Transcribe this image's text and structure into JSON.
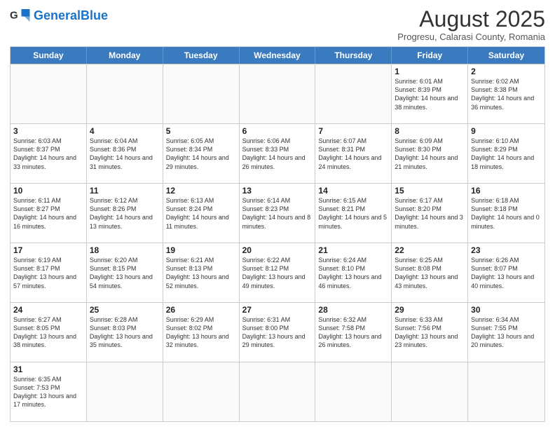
{
  "logo": {
    "text_normal": "General",
    "text_blue": "Blue"
  },
  "title": {
    "month_year": "August 2025",
    "location": "Progresu, Calarasi County, Romania"
  },
  "days_of_week": [
    "Sunday",
    "Monday",
    "Tuesday",
    "Wednesday",
    "Thursday",
    "Friday",
    "Saturday"
  ],
  "weeks": [
    [
      {
        "day": "",
        "info": ""
      },
      {
        "day": "",
        "info": ""
      },
      {
        "day": "",
        "info": ""
      },
      {
        "day": "",
        "info": ""
      },
      {
        "day": "",
        "info": ""
      },
      {
        "day": "1",
        "info": "Sunrise: 6:01 AM\nSunset: 8:39 PM\nDaylight: 14 hours and 38 minutes."
      },
      {
        "day": "2",
        "info": "Sunrise: 6:02 AM\nSunset: 8:38 PM\nDaylight: 14 hours and 36 minutes."
      }
    ],
    [
      {
        "day": "3",
        "info": "Sunrise: 6:03 AM\nSunset: 8:37 PM\nDaylight: 14 hours and 33 minutes."
      },
      {
        "day": "4",
        "info": "Sunrise: 6:04 AM\nSunset: 8:36 PM\nDaylight: 14 hours and 31 minutes."
      },
      {
        "day": "5",
        "info": "Sunrise: 6:05 AM\nSunset: 8:34 PM\nDaylight: 14 hours and 29 minutes."
      },
      {
        "day": "6",
        "info": "Sunrise: 6:06 AM\nSunset: 8:33 PM\nDaylight: 14 hours and 26 minutes."
      },
      {
        "day": "7",
        "info": "Sunrise: 6:07 AM\nSunset: 8:31 PM\nDaylight: 14 hours and 24 minutes."
      },
      {
        "day": "8",
        "info": "Sunrise: 6:09 AM\nSunset: 8:30 PM\nDaylight: 14 hours and 21 minutes."
      },
      {
        "day": "9",
        "info": "Sunrise: 6:10 AM\nSunset: 8:29 PM\nDaylight: 14 hours and 18 minutes."
      }
    ],
    [
      {
        "day": "10",
        "info": "Sunrise: 6:11 AM\nSunset: 8:27 PM\nDaylight: 14 hours and 16 minutes."
      },
      {
        "day": "11",
        "info": "Sunrise: 6:12 AM\nSunset: 8:26 PM\nDaylight: 14 hours and 13 minutes."
      },
      {
        "day": "12",
        "info": "Sunrise: 6:13 AM\nSunset: 8:24 PM\nDaylight: 14 hours and 11 minutes."
      },
      {
        "day": "13",
        "info": "Sunrise: 6:14 AM\nSunset: 8:23 PM\nDaylight: 14 hours and 8 minutes."
      },
      {
        "day": "14",
        "info": "Sunrise: 6:15 AM\nSunset: 8:21 PM\nDaylight: 14 hours and 5 minutes."
      },
      {
        "day": "15",
        "info": "Sunrise: 6:17 AM\nSunset: 8:20 PM\nDaylight: 14 hours and 3 minutes."
      },
      {
        "day": "16",
        "info": "Sunrise: 6:18 AM\nSunset: 8:18 PM\nDaylight: 14 hours and 0 minutes."
      }
    ],
    [
      {
        "day": "17",
        "info": "Sunrise: 6:19 AM\nSunset: 8:17 PM\nDaylight: 13 hours and 57 minutes."
      },
      {
        "day": "18",
        "info": "Sunrise: 6:20 AM\nSunset: 8:15 PM\nDaylight: 13 hours and 54 minutes."
      },
      {
        "day": "19",
        "info": "Sunrise: 6:21 AM\nSunset: 8:13 PM\nDaylight: 13 hours and 52 minutes."
      },
      {
        "day": "20",
        "info": "Sunrise: 6:22 AM\nSunset: 8:12 PM\nDaylight: 13 hours and 49 minutes."
      },
      {
        "day": "21",
        "info": "Sunrise: 6:24 AM\nSunset: 8:10 PM\nDaylight: 13 hours and 46 minutes."
      },
      {
        "day": "22",
        "info": "Sunrise: 6:25 AM\nSunset: 8:08 PM\nDaylight: 13 hours and 43 minutes."
      },
      {
        "day": "23",
        "info": "Sunrise: 6:26 AM\nSunset: 8:07 PM\nDaylight: 13 hours and 40 minutes."
      }
    ],
    [
      {
        "day": "24",
        "info": "Sunrise: 6:27 AM\nSunset: 8:05 PM\nDaylight: 13 hours and 38 minutes."
      },
      {
        "day": "25",
        "info": "Sunrise: 6:28 AM\nSunset: 8:03 PM\nDaylight: 13 hours and 35 minutes."
      },
      {
        "day": "26",
        "info": "Sunrise: 6:29 AM\nSunset: 8:02 PM\nDaylight: 13 hours and 32 minutes."
      },
      {
        "day": "27",
        "info": "Sunrise: 6:31 AM\nSunset: 8:00 PM\nDaylight: 13 hours and 29 minutes."
      },
      {
        "day": "28",
        "info": "Sunrise: 6:32 AM\nSunset: 7:58 PM\nDaylight: 13 hours and 26 minutes."
      },
      {
        "day": "29",
        "info": "Sunrise: 6:33 AM\nSunset: 7:56 PM\nDaylight: 13 hours and 23 minutes."
      },
      {
        "day": "30",
        "info": "Sunrise: 6:34 AM\nSunset: 7:55 PM\nDaylight: 13 hours and 20 minutes."
      }
    ],
    [
      {
        "day": "31",
        "info": "Sunrise: 6:35 AM\nSunset: 7:53 PM\nDaylight: 13 hours and 17 minutes."
      },
      {
        "day": "",
        "info": ""
      },
      {
        "day": "",
        "info": ""
      },
      {
        "day": "",
        "info": ""
      },
      {
        "day": "",
        "info": ""
      },
      {
        "day": "",
        "info": ""
      },
      {
        "day": "",
        "info": ""
      }
    ]
  ]
}
